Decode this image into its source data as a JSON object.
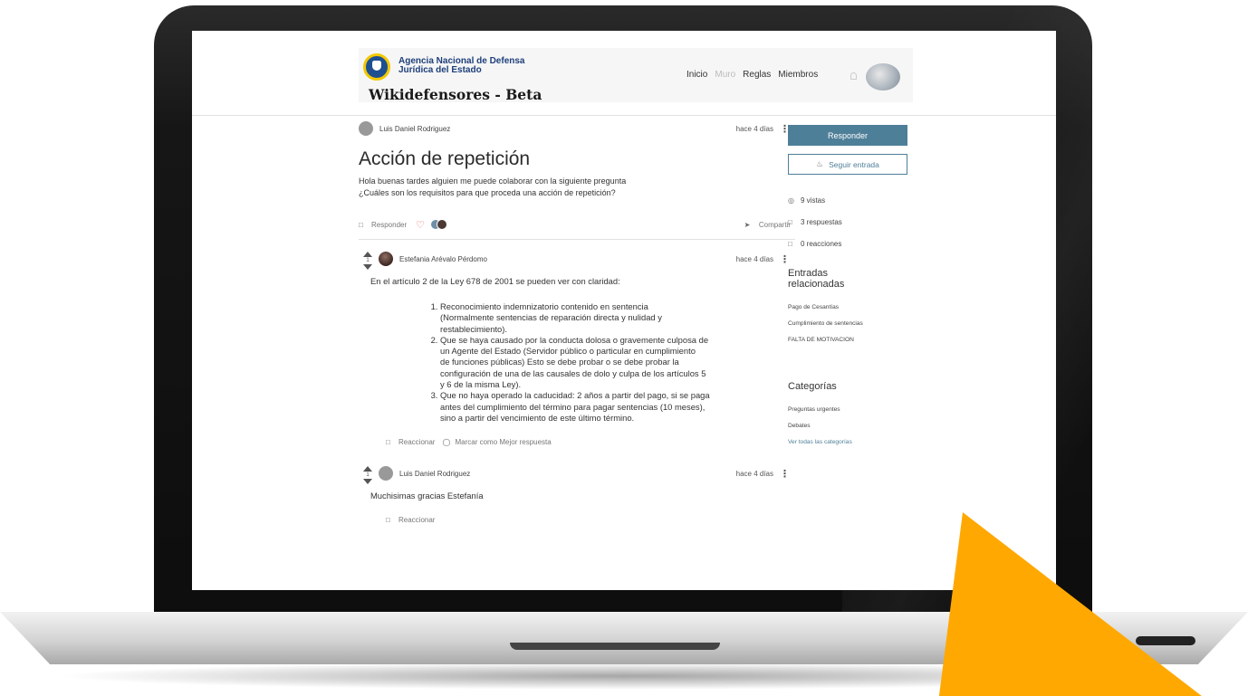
{
  "brand": {
    "agency_line1": "Agencia Nacional de Defensa",
    "agency_line2": "Jurídica del Estado",
    "site_title": "Wikidefensores - Beta",
    "seal_color": "#1d4f91"
  },
  "nav": {
    "items": [
      "Inicio",
      "Muro",
      "Reglas",
      "Miembros"
    ]
  },
  "post": {
    "author": "Luis Daniel Rodriguez",
    "time": "hace 4 días",
    "title": "Acción de repetición",
    "body_line1": "Hola buenas tardes alguien me puede colaborar con la siguiente pregunta",
    "body_line2": "¿Cuáles son los requisitos para que proceda una acción de repetición?",
    "reply_label": "Responder",
    "share_label": "Compartir"
  },
  "answers": [
    {
      "author": "Estefania Arévalo Pérdomo",
      "time": "hace 4 días",
      "votes": "1",
      "text": "En el artículo 2 de la Ley 678 de 2001 se pueden ver con claridad:",
      "items": [
        [
          "Reconocimiento indemnizatorio contenido en sentencia",
          "(Normalmente sentencias de reparación directa y nulidad y",
          "restablecimiento)."
        ],
        [
          "Que se haya causado por la conducta dolosa o gravemente culposa de",
          "un Agente del Estado (Servidor público o particular en cumplimiento",
          "de funciones públicas) Esto se debe probar o se debe probar la",
          "configuración de una de las causales de dolo y culpa de los artículos 5",
          "y 6 de la misma Ley)."
        ],
        [
          "Que no haya operado la caducidad: 2 años a partir del pago, si se paga",
          "antes del cumplimiento del término para pagar sentencias (10 meses),",
          "sino a partir del vencimiento de este último término."
        ]
      ],
      "react_label": "Reaccionar",
      "best_label": "Marcar como Mejor respuesta"
    },
    {
      "author": "Luis Daniel Rodriguez",
      "time": "hace 4 días",
      "votes": "1",
      "text": "Muchisimas gracias Estefanía",
      "react_label": "Reaccionar"
    }
  ],
  "sidebar": {
    "reply_button": "Responder",
    "follow_button": "Seguir entrada",
    "views": "9 vistas",
    "replies": "3 respuestas",
    "reactions": "0 reacciones",
    "related_title": "Entradas relacionadas",
    "related": [
      "Pago de Cesantías",
      "Cumplimiento de sentencias",
      "FALTA DE MOTIVACION"
    ],
    "categories_title": "Categorías",
    "categories": [
      "Preguntas urgentes",
      "Debates"
    ],
    "all_categories": "Ver todas las categorías"
  },
  "colors": {
    "accent": "#4e7f98",
    "heart": "#e26b6b",
    "decorative_arrow": "#ffa802"
  }
}
